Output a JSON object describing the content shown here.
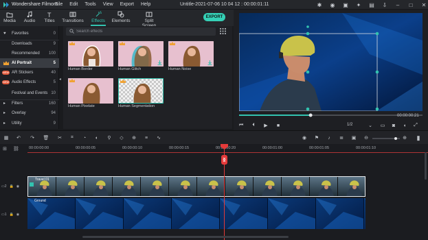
{
  "app": {
    "name": "Wondershare Filmora",
    "menu": [
      "File",
      "Edit",
      "Tools",
      "View",
      "Export",
      "Help"
    ],
    "document_title": "Untitle-2021-07-06 10 04 12 : 00:00:01:11"
  },
  "top_tabs": [
    {
      "label": "Media",
      "icon": "folder-icon"
    },
    {
      "label": "Audio",
      "icon": "music-note-icon"
    },
    {
      "label": "Titles",
      "icon": "text-icon"
    },
    {
      "label": "Transitions",
      "icon": "transition-icon"
    },
    {
      "label": "Effects",
      "icon": "effects-icon",
      "active": true
    },
    {
      "label": "Elements",
      "icon": "elements-icon"
    },
    {
      "label": "Split Screen",
      "icon": "split-screen-icon"
    }
  ],
  "export_label": "EXPORT",
  "sidebar": {
    "items": [
      {
        "label": "Favorites",
        "count": "0",
        "icon": "heart-icon"
      },
      {
        "label": "Downloads",
        "count": "9"
      },
      {
        "label": "Recommended",
        "count": "100"
      },
      {
        "label": "AI Portrait",
        "count": "5",
        "icon": "crown-icon",
        "active": true
      },
      {
        "label": "AR Stickers",
        "count": "40",
        "badge": "NEW"
      },
      {
        "label": "Audio Effects",
        "count": "5",
        "badge": "NEW"
      },
      {
        "label": "Festival and Events",
        "count": "10"
      },
      {
        "label": "Filters",
        "count": "160",
        "icon": "expand-arrow-icon"
      },
      {
        "label": "Overlay",
        "count": "94",
        "icon": "expand-arrow-icon"
      },
      {
        "label": "Utility",
        "count": "9",
        "icon": "expand-arrow-icon"
      }
    ]
  },
  "search": {
    "placeholder": "Search effects"
  },
  "effects": [
    {
      "label": "Human Border"
    },
    {
      "label": "Human Glitch"
    },
    {
      "label": "Human Noise"
    },
    {
      "label": "Human Pixelate"
    },
    {
      "label": "Human Segmentation"
    }
  ],
  "preview": {
    "timecode": "00:00:00:21",
    "progress": 0.39,
    "ratio": "1/2"
  },
  "timeline": {
    "ruler": [
      "00:00:00:00",
      "00:00:00:05",
      "00:00:00:10",
      "00:00:00:15",
      "00:00:00:20",
      "00:00:01:00",
      "00:00:01:05",
      "00:00:01:10"
    ],
    "clips": [
      {
        "title": "Travel 01"
      },
      {
        "title": "Ground"
      }
    ]
  },
  "colors": {
    "accent": "#33c3b0",
    "playhead": "#e53a3a",
    "export": "#35d0b6"
  }
}
